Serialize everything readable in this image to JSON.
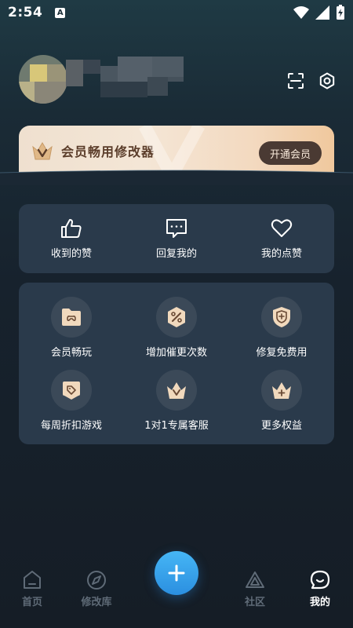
{
  "status_bar": {
    "time": "2:54",
    "notification_letter": "A"
  },
  "profile": {
    "avatar_blurred": true
  },
  "vip_banner": {
    "title": "会员畅用修改器",
    "button_label": "开通会员"
  },
  "social_card": {
    "items": [
      {
        "label": "收到的赞",
        "icon": "thumbs-up-icon"
      },
      {
        "label": "回复我的",
        "icon": "chat-bubble-icon"
      },
      {
        "label": "我的点赞",
        "icon": "heart-icon"
      }
    ]
  },
  "benefits_card": {
    "items": [
      {
        "label": "会员畅玩",
        "icon": "game-folder-icon"
      },
      {
        "label": "增加催更次数",
        "icon": "ticket-icon"
      },
      {
        "label": "修复免费用",
        "icon": "shield-icon"
      },
      {
        "label": "每周折扣游戏",
        "icon": "discount-tag-icon"
      },
      {
        "label": "1对1专属客服",
        "icon": "crown-v-icon"
      },
      {
        "label": "更多权益",
        "icon": "crown-plus-icon"
      }
    ]
  },
  "bottom_nav": {
    "items": [
      {
        "label": "首页",
        "icon": "home-icon",
        "active": false
      },
      {
        "label": "修改库",
        "icon": "compass-icon",
        "active": false
      },
      {
        "label": "社区",
        "icon": "community-icon",
        "active": false
      },
      {
        "label": "我的",
        "icon": "profile-chat-icon",
        "active": true
      }
    ],
    "fab_icon": "plus-icon"
  },
  "colors": {
    "accent_blue": "#2b8fe0",
    "vip_gold": "#f0c89d",
    "card_bg": "#2a3a4b"
  }
}
